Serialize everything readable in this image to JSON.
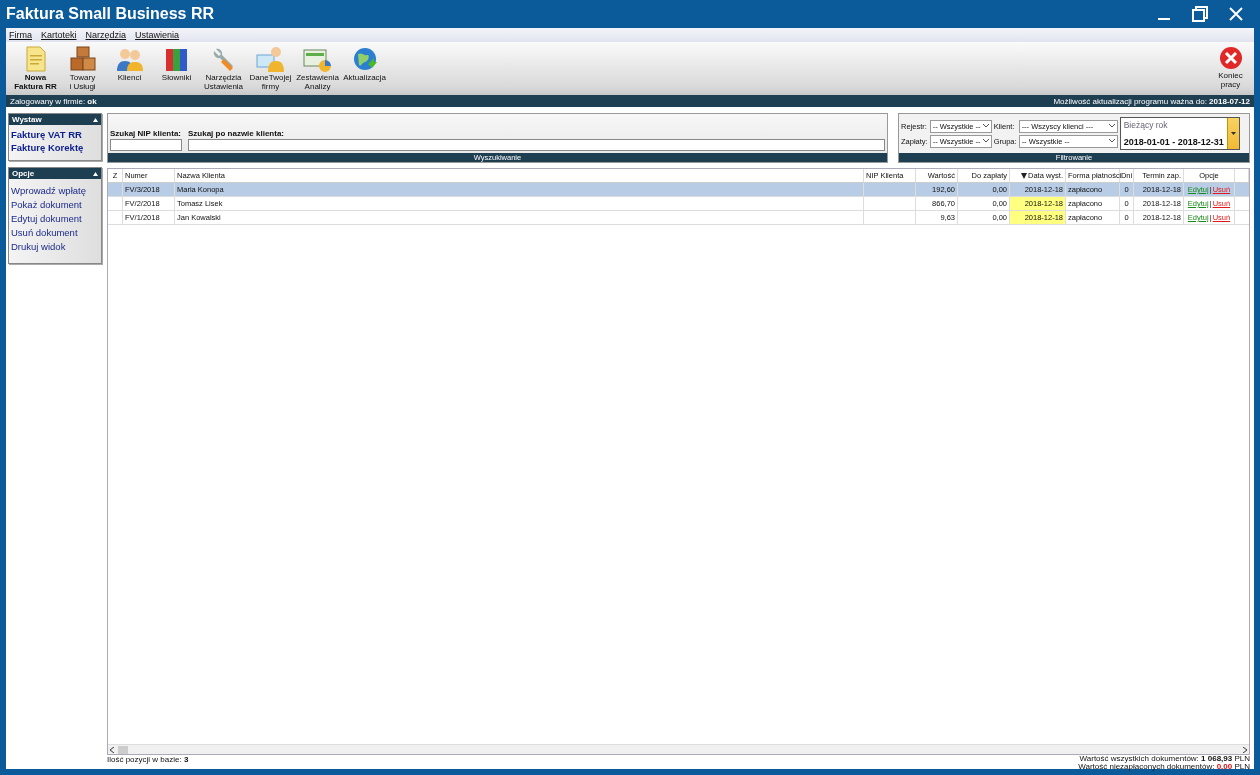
{
  "window": {
    "title": "Faktura Small Business RR"
  },
  "menu": [
    "Firma",
    "Kartoteki",
    "Narzędzia",
    "Ustawienia"
  ],
  "toolbar": [
    {
      "label": "Nowa\nFaktura RR",
      "bold": true
    },
    {
      "label": "Towary\ni Usługi",
      "bold": false
    },
    {
      "label": "Klienci",
      "bold": false
    },
    {
      "label": "Słowniki",
      "bold": false
    },
    {
      "label": "Narzędzia\nUstawienia",
      "bold": false
    },
    {
      "label": "DaneTwojej\nfirmy",
      "bold": false
    },
    {
      "label": "Zestawienia\nAnalizy",
      "bold": false
    },
    {
      "label": "Aktualizacja",
      "bold": false
    }
  ],
  "exit_button": {
    "label": "Koniec\npracy"
  },
  "info_bar": {
    "left": "Zalogowany w firmie: **ok**",
    "right": "Możliwość aktualizacji programu ważna do: **2018-07-12**"
  },
  "sidebar": [
    {
      "title": "Wystaw",
      "kind": "bold",
      "items": [
        "Fakturę VAT RR",
        "Fakturę Korektę"
      ]
    },
    {
      "title": "Opcje",
      "kind": "plain",
      "items": [
        "Wprowadź wpłatę",
        "Pokaż dokument",
        "Edytuj dokument",
        "Usuń dokument",
        "Drukuj widok"
      ]
    }
  ],
  "search": {
    "footer": "Wyszukiwanie",
    "nip_label": "Szukaj NIP klienta:",
    "name_label": "Szukaj po nazwie klienta:"
  },
  "filter": {
    "footer": "Filtrowanie",
    "selects": [
      {
        "label": "Rejestr:",
        "value": "-- Wszystkie --"
      },
      {
        "label": "Klient:",
        "value": "--- Wszyscy klienci ---"
      },
      {
        "label": "Zapłaty:",
        "value": "-- Wszystkie --"
      },
      {
        "label": "Grupa:",
        "value": "-- Wszystkie --"
      }
    ],
    "period": {
      "label": "Bieżący rok",
      "value": "2018-01-01 - 2018-12-31"
    }
  },
  "table": {
    "columns": [
      {
        "label": "Z",
        "sorted": false
      },
      {
        "label": "Numer",
        "sorted": false
      },
      {
        "label": "Nazwa Klienta",
        "sorted": false
      },
      {
        "label": "NIP Klienta",
        "sorted": false
      },
      {
        "label": "Wartość",
        "sorted": false
      },
      {
        "label": "Do zapłaty",
        "sorted": false
      },
      {
        "label": "Data wyst.",
        "sorted": true
      },
      {
        "label": "Forma płatności",
        "sorted": false
      },
      {
        "label": "Dni",
        "sorted": false
      },
      {
        "label": "Termin zap.",
        "sorted": false
      },
      {
        "label": "Opcje",
        "sorted": false
      }
    ],
    "rows": [
      {
        "selected": true,
        "numer": "FV/3/2018",
        "name": "Maria Konopa",
        "value": "192,60",
        "due": "0,00",
        "date": "2018-12-18",
        "date_highlighted": false,
        "payment": "zapłacono",
        "days": "0",
        "term": "2018-12-18",
        "edit": "Edytuj",
        "sep": "|",
        "delete": "Usuń"
      },
      {
        "selected": false,
        "numer": "FV/2/2018",
        "name": "Tomasz Lisek",
        "value": "866,70",
        "due": "0,00",
        "date": "2018-12-18",
        "date_highlighted": true,
        "payment": "zapłacono",
        "days": "0",
        "term": "2018-12-18",
        "edit": "Edytuj",
        "sep": "|",
        "delete": "Usuń"
      },
      {
        "selected": false,
        "numer": "FV/1/2018",
        "name": "Jan Kowalski",
        "value": "9,63",
        "due": "0,00",
        "date": "2018-12-18",
        "date_highlighted": true,
        "payment": "zapłacono",
        "days": "0",
        "term": "2018-12-18",
        "edit": "Edytuj",
        "sep": "|",
        "delete": "Usuń"
      }
    ]
  },
  "footer": {
    "count": "Ilość pozycji w bazie: **3**",
    "totals": [
      {
        "label": "Wartość wszystkich dokumentów:",
        "value": "1 068,93",
        "unit": "PLN",
        "kind": "normal"
      },
      {
        "label": "Wartość niezapłaconych dokumentów:",
        "value": "0,00",
        "unit": "PLN",
        "kind": "alert"
      }
    ]
  }
}
